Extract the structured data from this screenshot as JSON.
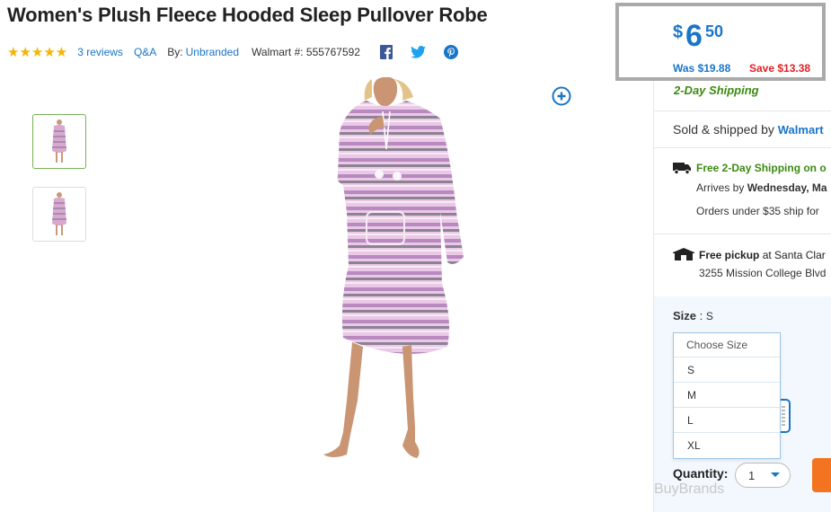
{
  "product": {
    "title": "Women's Plush Fleece Hooded Sleep Pullover Robe",
    "stars": "★★★★★",
    "rating": 5,
    "reviews_label": "3 reviews",
    "qa_label": "Q&A",
    "by_label": "By:",
    "brand": "Unbranded",
    "walmart_number": "Walmart #: 555767592"
  },
  "share": {
    "icons": [
      "facebook-icon",
      "twitter-icon",
      "pinterest-icon"
    ]
  },
  "price": {
    "currency": "$",
    "dollars": "6",
    "cents": "50",
    "was": "Was $19.88",
    "save": "Save $13.38"
  },
  "shipping": {
    "two_day": "2-Day Shipping",
    "sold_prefix": "Sold & shipped by",
    "seller": "Walmart",
    "free_2day": "Free 2-Day Shipping on o",
    "arrives_prefix": "Arrives by",
    "arrives_date": "Wednesday, Ma",
    "orders_under": "Orders under $35 ship for",
    "pickup_prefix": "Free pickup",
    "pickup_store": "at Santa Clar",
    "pickup_address": "3255 Mission College Blvd"
  },
  "size": {
    "label": "Size",
    "selected": "S",
    "dropdown_header": "Choose Size",
    "options": [
      "S",
      "M",
      "L",
      "XL"
    ]
  },
  "quantity": {
    "label": "Quantity:",
    "value": "1"
  },
  "watermark": "BuyBrands",
  "colors": {
    "link_blue": "#1a75c7",
    "star_gold": "#f5b500",
    "green": "#3c8a12",
    "save_red": "#e31e24",
    "cta_orange": "#f47321"
  }
}
